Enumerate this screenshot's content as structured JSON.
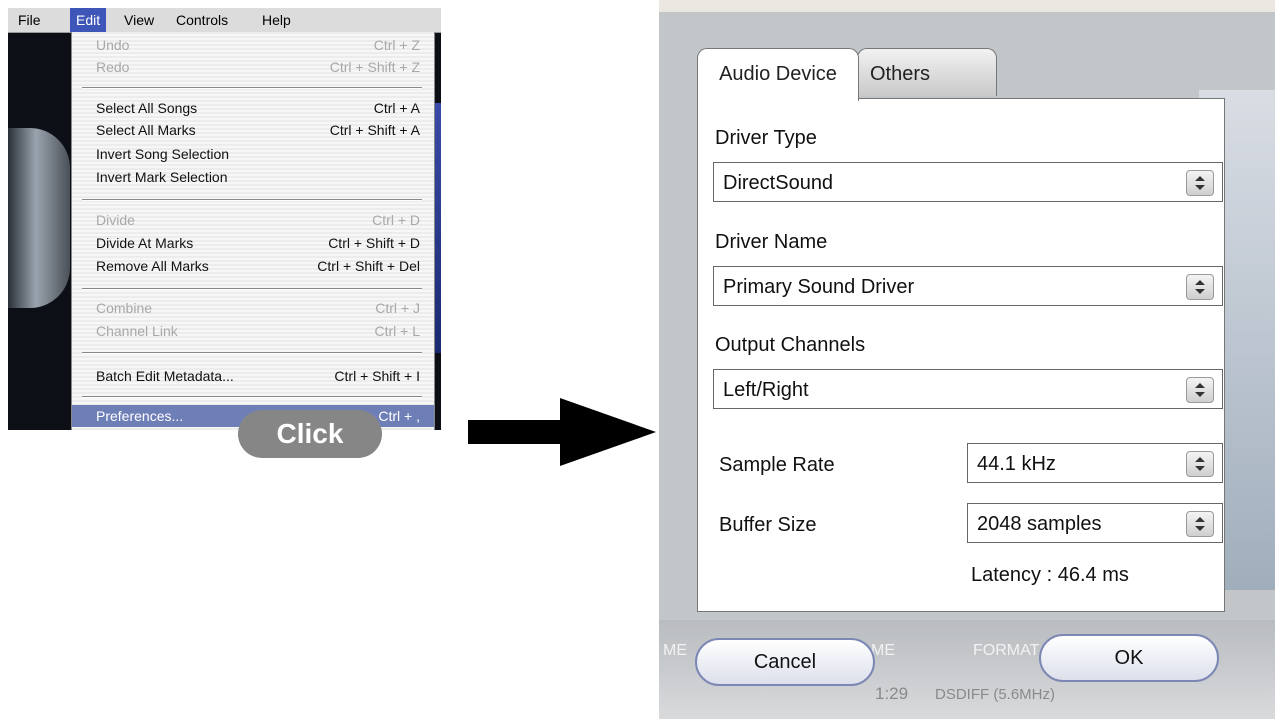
{
  "menu_screenshot": {
    "menubar": [
      "File",
      "Edit",
      "View",
      "Controls",
      "Help"
    ],
    "active_menu": "Edit",
    "items": [
      {
        "label": "Undo",
        "shortcut": "Ctrl + Z",
        "disabled": true
      },
      {
        "label": "Redo",
        "shortcut": "Ctrl + Shift + Z",
        "disabled": true
      },
      {
        "label": "Select All Songs",
        "shortcut": "Ctrl + A",
        "disabled": false
      },
      {
        "label": "Select All Marks",
        "shortcut": "Ctrl + Shift + A",
        "disabled": false
      },
      {
        "label": "Invert Song Selection",
        "shortcut": "",
        "disabled": false
      },
      {
        "label": "Invert Mark Selection",
        "shortcut": "",
        "disabled": false
      },
      {
        "label": "Divide",
        "shortcut": "Ctrl + D",
        "disabled": true
      },
      {
        "label": "Divide At Marks",
        "shortcut": "Ctrl + Shift + D",
        "disabled": false
      },
      {
        "label": "Remove All Marks",
        "shortcut": "Ctrl + Shift + Del",
        "disabled": false
      },
      {
        "label": "Combine",
        "shortcut": "Ctrl + J",
        "disabled": true
      },
      {
        "label": "Channel Link",
        "shortcut": "Ctrl + L",
        "disabled": true
      },
      {
        "label": "Batch Edit Metadata...",
        "shortcut": "Ctrl + Shift + I",
        "disabled": false
      },
      {
        "label": "Preferences...",
        "shortcut": "Ctrl + ,",
        "disabled": false,
        "selected": true
      }
    ],
    "click_label": "Click"
  },
  "dialog_screenshot": {
    "tabs": [
      "Audio Device",
      "Others"
    ],
    "active_tab": "Audio Device",
    "driver_type": {
      "label": "Driver Type",
      "value": "DirectSound"
    },
    "driver_name": {
      "label": "Driver Name",
      "value": "Primary Sound Driver"
    },
    "output_channels": {
      "label": "Output Channels",
      "value": "Left/Right"
    },
    "sample_rate": {
      "label": "Sample Rate",
      "value": "44.1 kHz"
    },
    "buffer_size": {
      "label": "Buffer Size",
      "value": "2048 samples"
    },
    "latency": "Latency : 46.4 ms",
    "cancel_label": "Cancel",
    "ok_label": "OK",
    "background_row": {
      "time": "1:29",
      "format": "DSDIFF (5.6MHz)"
    },
    "background_headers": {
      "me": "ME",
      "me2": "ME",
      "format": "FORMAT"
    }
  }
}
